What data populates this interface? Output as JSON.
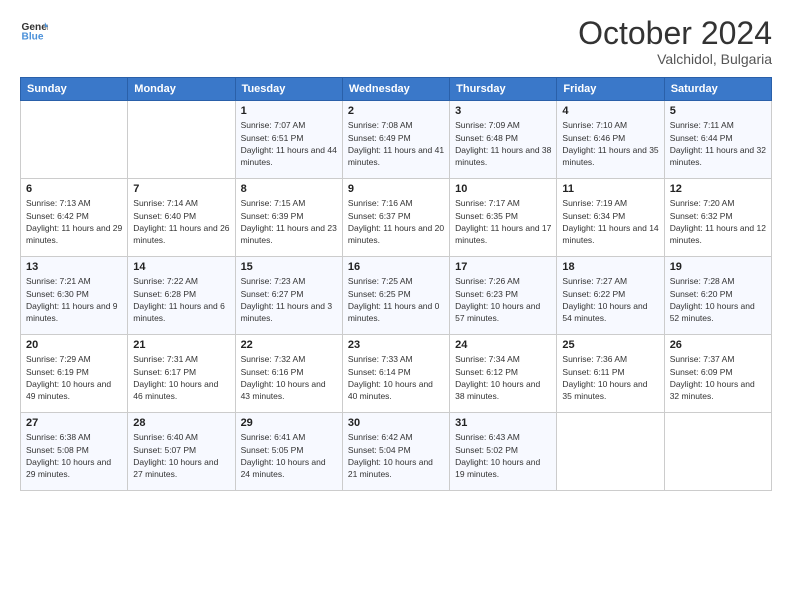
{
  "header": {
    "logo_line1": "General",
    "logo_line2": "Blue",
    "month": "October 2024",
    "location": "Valchidol, Bulgaria"
  },
  "days_of_week": [
    "Sunday",
    "Monday",
    "Tuesday",
    "Wednesday",
    "Thursday",
    "Friday",
    "Saturday"
  ],
  "weeks": [
    [
      {
        "num": "",
        "sunrise": "",
        "sunset": "",
        "daylight": ""
      },
      {
        "num": "",
        "sunrise": "",
        "sunset": "",
        "daylight": ""
      },
      {
        "num": "1",
        "sunrise": "Sunrise: 7:07 AM",
        "sunset": "Sunset: 6:51 PM",
        "daylight": "Daylight: 11 hours and 44 minutes."
      },
      {
        "num": "2",
        "sunrise": "Sunrise: 7:08 AM",
        "sunset": "Sunset: 6:49 PM",
        "daylight": "Daylight: 11 hours and 41 minutes."
      },
      {
        "num": "3",
        "sunrise": "Sunrise: 7:09 AM",
        "sunset": "Sunset: 6:48 PM",
        "daylight": "Daylight: 11 hours and 38 minutes."
      },
      {
        "num": "4",
        "sunrise": "Sunrise: 7:10 AM",
        "sunset": "Sunset: 6:46 PM",
        "daylight": "Daylight: 11 hours and 35 minutes."
      },
      {
        "num": "5",
        "sunrise": "Sunrise: 7:11 AM",
        "sunset": "Sunset: 6:44 PM",
        "daylight": "Daylight: 11 hours and 32 minutes."
      }
    ],
    [
      {
        "num": "6",
        "sunrise": "Sunrise: 7:13 AM",
        "sunset": "Sunset: 6:42 PM",
        "daylight": "Daylight: 11 hours and 29 minutes."
      },
      {
        "num": "7",
        "sunrise": "Sunrise: 7:14 AM",
        "sunset": "Sunset: 6:40 PM",
        "daylight": "Daylight: 11 hours and 26 minutes."
      },
      {
        "num": "8",
        "sunrise": "Sunrise: 7:15 AM",
        "sunset": "Sunset: 6:39 PM",
        "daylight": "Daylight: 11 hours and 23 minutes."
      },
      {
        "num": "9",
        "sunrise": "Sunrise: 7:16 AM",
        "sunset": "Sunset: 6:37 PM",
        "daylight": "Daylight: 11 hours and 20 minutes."
      },
      {
        "num": "10",
        "sunrise": "Sunrise: 7:17 AM",
        "sunset": "Sunset: 6:35 PM",
        "daylight": "Daylight: 11 hours and 17 minutes."
      },
      {
        "num": "11",
        "sunrise": "Sunrise: 7:19 AM",
        "sunset": "Sunset: 6:34 PM",
        "daylight": "Daylight: 11 hours and 14 minutes."
      },
      {
        "num": "12",
        "sunrise": "Sunrise: 7:20 AM",
        "sunset": "Sunset: 6:32 PM",
        "daylight": "Daylight: 11 hours and 12 minutes."
      }
    ],
    [
      {
        "num": "13",
        "sunrise": "Sunrise: 7:21 AM",
        "sunset": "Sunset: 6:30 PM",
        "daylight": "Daylight: 11 hours and 9 minutes."
      },
      {
        "num": "14",
        "sunrise": "Sunrise: 7:22 AM",
        "sunset": "Sunset: 6:28 PM",
        "daylight": "Daylight: 11 hours and 6 minutes."
      },
      {
        "num": "15",
        "sunrise": "Sunrise: 7:23 AM",
        "sunset": "Sunset: 6:27 PM",
        "daylight": "Daylight: 11 hours and 3 minutes."
      },
      {
        "num": "16",
        "sunrise": "Sunrise: 7:25 AM",
        "sunset": "Sunset: 6:25 PM",
        "daylight": "Daylight: 11 hours and 0 minutes."
      },
      {
        "num": "17",
        "sunrise": "Sunrise: 7:26 AM",
        "sunset": "Sunset: 6:23 PM",
        "daylight": "Daylight: 10 hours and 57 minutes."
      },
      {
        "num": "18",
        "sunrise": "Sunrise: 7:27 AM",
        "sunset": "Sunset: 6:22 PM",
        "daylight": "Daylight: 10 hours and 54 minutes."
      },
      {
        "num": "19",
        "sunrise": "Sunrise: 7:28 AM",
        "sunset": "Sunset: 6:20 PM",
        "daylight": "Daylight: 10 hours and 52 minutes."
      }
    ],
    [
      {
        "num": "20",
        "sunrise": "Sunrise: 7:29 AM",
        "sunset": "Sunset: 6:19 PM",
        "daylight": "Daylight: 10 hours and 49 minutes."
      },
      {
        "num": "21",
        "sunrise": "Sunrise: 7:31 AM",
        "sunset": "Sunset: 6:17 PM",
        "daylight": "Daylight: 10 hours and 46 minutes."
      },
      {
        "num": "22",
        "sunrise": "Sunrise: 7:32 AM",
        "sunset": "Sunset: 6:16 PM",
        "daylight": "Daylight: 10 hours and 43 minutes."
      },
      {
        "num": "23",
        "sunrise": "Sunrise: 7:33 AM",
        "sunset": "Sunset: 6:14 PM",
        "daylight": "Daylight: 10 hours and 40 minutes."
      },
      {
        "num": "24",
        "sunrise": "Sunrise: 7:34 AM",
        "sunset": "Sunset: 6:12 PM",
        "daylight": "Daylight: 10 hours and 38 minutes."
      },
      {
        "num": "25",
        "sunrise": "Sunrise: 7:36 AM",
        "sunset": "Sunset: 6:11 PM",
        "daylight": "Daylight: 10 hours and 35 minutes."
      },
      {
        "num": "26",
        "sunrise": "Sunrise: 7:37 AM",
        "sunset": "Sunset: 6:09 PM",
        "daylight": "Daylight: 10 hours and 32 minutes."
      }
    ],
    [
      {
        "num": "27",
        "sunrise": "Sunrise: 6:38 AM",
        "sunset": "Sunset: 5:08 PM",
        "daylight": "Daylight: 10 hours and 29 minutes."
      },
      {
        "num": "28",
        "sunrise": "Sunrise: 6:40 AM",
        "sunset": "Sunset: 5:07 PM",
        "daylight": "Daylight: 10 hours and 27 minutes."
      },
      {
        "num": "29",
        "sunrise": "Sunrise: 6:41 AM",
        "sunset": "Sunset: 5:05 PM",
        "daylight": "Daylight: 10 hours and 24 minutes."
      },
      {
        "num": "30",
        "sunrise": "Sunrise: 6:42 AM",
        "sunset": "Sunset: 5:04 PM",
        "daylight": "Daylight: 10 hours and 21 minutes."
      },
      {
        "num": "31",
        "sunrise": "Sunrise: 6:43 AM",
        "sunset": "Sunset: 5:02 PM",
        "daylight": "Daylight: 10 hours and 19 minutes."
      },
      {
        "num": "",
        "sunrise": "",
        "sunset": "",
        "daylight": ""
      },
      {
        "num": "",
        "sunrise": "",
        "sunset": "",
        "daylight": ""
      }
    ]
  ]
}
